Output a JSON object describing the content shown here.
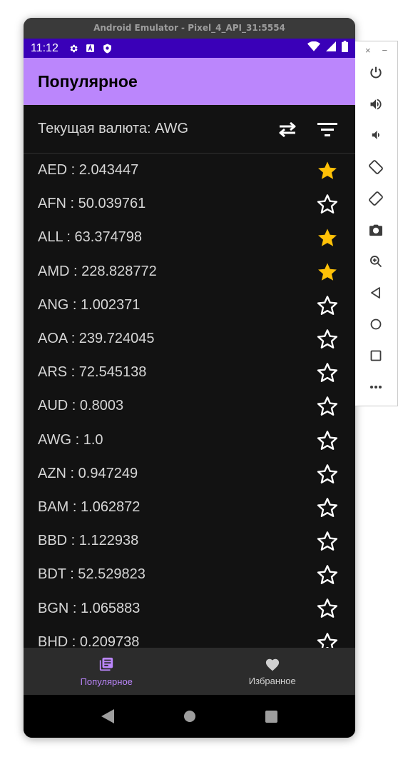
{
  "window": {
    "title": "Android Emulator - Pixel_4_API_31:5554"
  },
  "statusbar": {
    "time": "11:12"
  },
  "appbar": {
    "title": "Популярное"
  },
  "currency": {
    "label": "Текущая валюта: AWG"
  },
  "rates": [
    {
      "text": "AED : 2.043447",
      "favorite": true
    },
    {
      "text": "AFN : 50.039761",
      "favorite": false
    },
    {
      "text": "ALL : 63.374798",
      "favorite": true
    },
    {
      "text": "AMD : 228.828772",
      "favorite": true
    },
    {
      "text": "ANG : 1.002371",
      "favorite": false
    },
    {
      "text": "AOA : 239.724045",
      "favorite": false
    },
    {
      "text": "ARS : 72.545138",
      "favorite": false
    },
    {
      "text": "AUD : 0.8003",
      "favorite": false
    },
    {
      "text": "AWG : 1.0",
      "favorite": false
    },
    {
      "text": "AZN : 0.947249",
      "favorite": false
    },
    {
      "text": "BAM : 1.062872",
      "favorite": false
    },
    {
      "text": "BBD : 1.122938",
      "favorite": false
    },
    {
      "text": "BDT : 52.529823",
      "favorite": false
    },
    {
      "text": "BGN : 1.065883",
      "favorite": false
    },
    {
      "text": "BHD : 0.209738",
      "favorite": false
    }
  ],
  "bottomnav": {
    "popular_label": "Популярное",
    "favorites_label": "Избранное"
  },
  "colors": {
    "accent": "#bb86fc",
    "status_bar": "#3a00b8",
    "star_filled": "#ffc107",
    "background": "#121212"
  },
  "sidebar": {
    "close": "×",
    "minimize": "−"
  }
}
